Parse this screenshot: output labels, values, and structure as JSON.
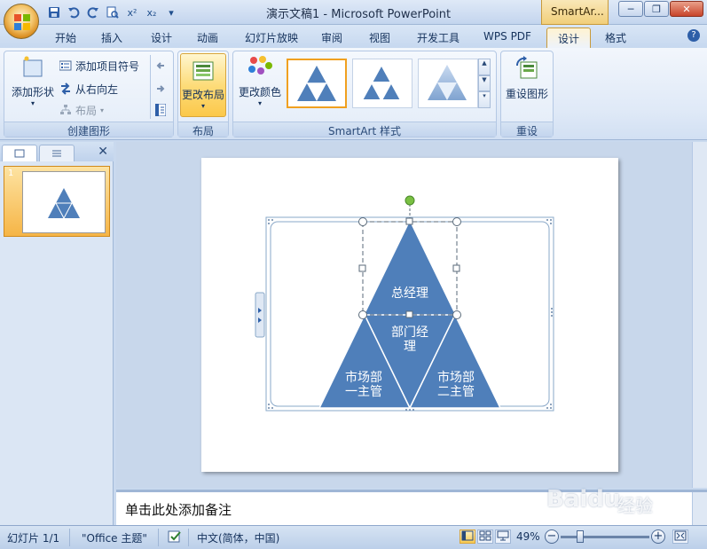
{
  "window": {
    "title": "演示文稿1 - Microsoft PowerPoint",
    "context_tab_group": "SmartAr..."
  },
  "qat": {
    "icons": [
      "save-icon",
      "undo-icon",
      "redo-icon",
      "print-preview-icon",
      "superscript-icon",
      "subscript-icon",
      "customize-icon"
    ],
    "superscript_label": "x²",
    "subscript_label": "x₂"
  },
  "tabs": [
    "开始",
    "插入",
    "设计",
    "动画",
    "幻灯片放映",
    "审阅",
    "视图",
    "开发工具",
    "WPS PDF",
    "设计",
    "格式"
  ],
  "active_tab": "设计",
  "ribbon": {
    "create_graphic": {
      "label": "创建图形",
      "add_shape": "添加形状",
      "add_bullet": "添加项目符号",
      "right_to_left": "从右向左",
      "layout": "布局"
    },
    "layout_group": {
      "label": "布局",
      "change_layout": "更改布局"
    },
    "smartart_styles": {
      "label": "SmartArt 样式",
      "change_colors": "更改颜色"
    },
    "reset_group": {
      "label": "重设",
      "reset_graphic": "重设图形"
    }
  },
  "slide_panel": {
    "slide_number": "1"
  },
  "smartart": {
    "top": "总经理",
    "middle": "部门经\n理",
    "bottom_left": "市场部\n一主管",
    "bottom_right": "市场部\n二主管",
    "fill_color": "#4f7fba",
    "selection_color": "#8aa8c8"
  },
  "notes": {
    "placeholder": "单击此处添加备注"
  },
  "status": {
    "slide_info": "幻灯片 1/1",
    "theme": "\"Office 主题\"",
    "language": "中文(简体，中国)",
    "zoom": "49%",
    "zoom_level": 0.49
  },
  "watermark": {
    "logo": "Baidu",
    "sub": "经验"
  }
}
